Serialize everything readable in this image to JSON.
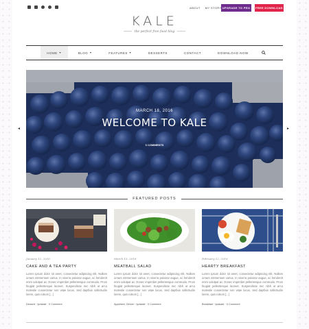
{
  "topbar": {
    "social_icons": [
      "facebook-icon",
      "twitter-icon",
      "instagram-icon",
      "pinterest-icon",
      "email-icon"
    ],
    "links": [
      "ABOUT",
      "MY STORY"
    ],
    "upgrade_label": "UPGRADE TO PRO",
    "free_label": "FREE DOWNLOAD",
    "colors": {
      "pro": "#6e2c8c",
      "free": "#e0244a"
    }
  },
  "site": {
    "logo": "KALE",
    "tagline": "the perfect free food blog"
  },
  "nav": {
    "items": [
      {
        "label": "HOME",
        "dropdown": true
      },
      {
        "label": "BLOG",
        "dropdown": true
      },
      {
        "label": "FEATURES",
        "dropdown": true
      },
      {
        "label": "DESSERTS",
        "dropdown": false
      },
      {
        "label": "CONTACT",
        "dropdown": false
      },
      {
        "label": "DOWNLOAD NOW",
        "dropdown": false
      }
    ]
  },
  "hero": {
    "date": "MARCH 18, 2016",
    "title": "WELCOME TO KALE",
    "comments": "0 COMMENTS"
  },
  "featured": {
    "heading": "FEATURED POSTS",
    "posts": [
      {
        "date": "January 12, 2016",
        "title": "CAKE AND A TEA PARTY",
        "excerpt": "Lorem ipsum dolor sit amet, consectetur adipiscing elit. Nullam ornare elementum varius. In viverra pulvinar augue, ac hendrerit enim volutpat ac. Donec imperdiet pellentesque commodo. Proin feugiat pellentesque laoreet. Suspendisse nec nibh ut arcu molestie consectetur non vitae lacus. Sed dapibus sollicitudin lorem, quis rutrum [...]",
        "meta": "Dessert · lyrakale · 0 Comment"
      },
      {
        "date": "March 13, 2016",
        "title": "MEATBALL SALAD",
        "excerpt": "Lorem ipsum dolor sit amet, consectetur adipiscing elit. Nullam ornare elementum varius. In viverra pulvinar augue, ac hendrerit enim volutpat ac. Donec imperdiet pellentesque commodo. Proin feugiat pellentesque laoreet. Suspendisse nec nibh ut arcu molestie consectetur non vitae lacus. Sed dapibus sollicitudin lorem, quis rutrum [...]",
        "meta": "Appetizer, Dinner · lyrakale · 0 Comment"
      },
      {
        "date": "February 12, 2016",
        "title": "HEARTY BREAKFAST",
        "excerpt": "Lorem ipsum dolor sit amet, consectetur adipiscing elit. Nullam ornare elementum varius. In viverra pulvinar augue, ac hendrerit enim volutpat ac. Donec imperdiet pellentesque commodo. Proin feugiat pellentesque laoreet. Suspendisse nec nibh ut arcu molestie consectetur non vitae lacus. Sed dapibus sollicitudin lorem, quis rutrum [...]",
        "meta": "Breakfast · lyrakale · 0 Comment"
      }
    ]
  }
}
